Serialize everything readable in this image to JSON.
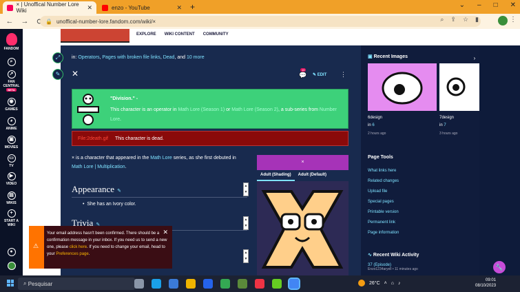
{
  "browser": {
    "tabs": [
      {
        "title": "× | Unoffical Number Lore Wiki",
        "active": true,
        "favicon_color": "#fa005a"
      },
      {
        "title": "enzo - YouTube",
        "active": false,
        "favicon_color": "#ff0000"
      }
    ],
    "new_tab": "+",
    "url": "unoffical-number-lore.fandom.com/wiki/×",
    "window_controls": [
      "⌄",
      "–",
      "□",
      "✕"
    ]
  },
  "fandom_sidebar": {
    "brand": "FANDOM",
    "items": [
      {
        "label": "FAN CENTRAL",
        "badge": "BETA"
      },
      {
        "label": "GAMES"
      },
      {
        "label": "ANIME"
      },
      {
        "label": "MOVIES"
      },
      {
        "label": "TV"
      },
      {
        "label": "VIDEO"
      },
      {
        "label": "WIKIS"
      },
      {
        "label": "START A WIKI"
      }
    ]
  },
  "wiki_nav": [
    "EXPLORE",
    "WIKI CONTENT",
    "COMMUNITY"
  ],
  "article": {
    "categories_prefix": "in:",
    "categories": [
      "Operators",
      "Pages with broken file links",
      "Dead"
    ],
    "categories_more": "10 more",
    "edit_label": "EDIT",
    "notifications": "10",
    "division_box": {
      "title": "\"Division.\" -",
      "text_before": "This character is an operator in",
      "link1": "Math Lore (Season 1)",
      "or": "or",
      "link2": "Math Lore (Season 2)",
      "text_mid": ", a sub-series from",
      "link3": "Number Lore",
      "end": "."
    },
    "dead_box": {
      "file": "File:2death.gif",
      "text": "This character is dead."
    },
    "intro": {
      "p1": "× is a character that appeared in the",
      "link1": "Math Lore",
      "p2": "series, as she first debuted in",
      "link2": "Math Lore | Multiplication",
      "p3": "."
    },
    "appearance_heading": "Appearance",
    "appearance_bullet": "She has an Ivory color.",
    "trivia_heading": "Trivia",
    "infobox": {
      "title": "×",
      "tabs": [
        "Adult (Shading)",
        "Adult (Default)"
      ]
    }
  },
  "right_rail": {
    "recent_images_heading": "Recent Images",
    "images": [
      {
        "name": "6design",
        "in": "in",
        "link": "6",
        "time": "2 hours ago"
      },
      {
        "name": "7design",
        "in": "in",
        "link": "7",
        "time": "3 hours ago"
      }
    ],
    "page_tools_heading": "Page Tools",
    "page_tools": [
      "What links here",
      "Related changes",
      "Upload file",
      "Special pages",
      "Printable version",
      "Permanent link",
      "Page information"
    ],
    "activity_heading": "Recent Wiki Activity",
    "activity_item": "37 (Episode)",
    "activity_sub": "Enzo1234aryell • 11 minutes ago"
  },
  "toast": {
    "line1": "Your email address hasn't been confirmed. There should be a confirmation message in your inbox. If you need us to send a new one, please",
    "link1": "click here",
    "line2": ". If you need to change your email, head to your",
    "link2": "Preferences page",
    "end": "."
  },
  "taskbar": {
    "search": "Pesquisar",
    "weather": "26°C",
    "time": "09:01",
    "date": "08/10/2023"
  }
}
